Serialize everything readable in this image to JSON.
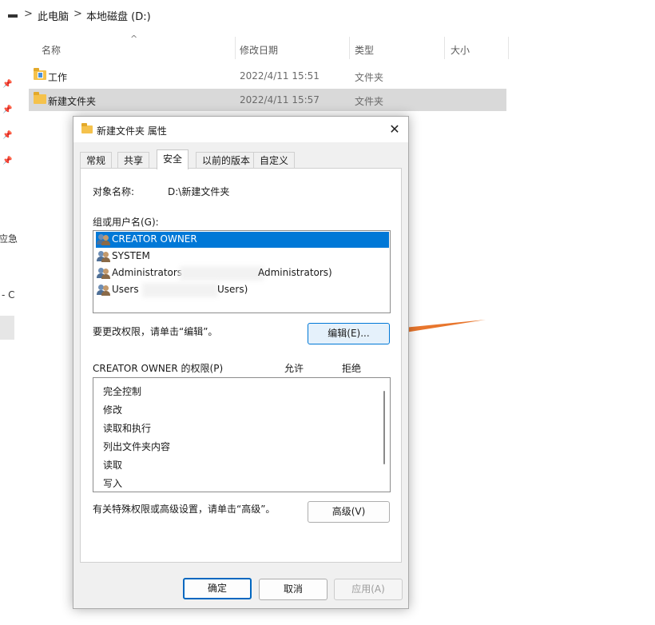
{
  "breadcrumb": {
    "sep1": ">",
    "item1": "此电脑",
    "sep2": ">",
    "item2": "本地磁盘 (D:)"
  },
  "columns": {
    "name": "名称",
    "date": "修改日期",
    "type": "类型",
    "size": "大小"
  },
  "files": [
    {
      "name": "工作",
      "date": "2022/4/11 15:51",
      "type": "文件夹"
    },
    {
      "name": "新建文件夹",
      "date": "2022/4/11 15:57",
      "type": "文件夹"
    }
  ],
  "left_fragments": [
    "应急",
    "- C"
  ],
  "dialog": {
    "title": "新建文件夹 属性",
    "close": "✕",
    "tabs": [
      "常规",
      "共享",
      "安全",
      "以前的版本",
      "自定义"
    ],
    "active_tab": "安全",
    "object_label": "对象名称:",
    "object_value": "D:\\新建文件夹",
    "group_label": "组或用户名(G):",
    "users": [
      {
        "name": "CREATOR OWNER",
        "selected": true
      },
      {
        "name": "SYSTEM",
        "selected": false
      },
      {
        "name": "Administrators",
        "suffix": "Administrators)",
        "selected": false
      },
      {
        "name": "Users",
        "suffix": "Users)",
        "selected": false
      }
    ],
    "edit_hint": "要更改权限，请单击“编辑”。",
    "edit_button": "编辑(E)...",
    "perm_label": "CREATOR OWNER 的权限(P)",
    "allow_label": "允许",
    "deny_label": "拒绝",
    "permissions": [
      "完全控制",
      "修改",
      "读取和执行",
      "列出文件夹内容",
      "读取",
      "写入"
    ],
    "advanced_hint": "有关特殊权限或高级设置，请单击“高级”。",
    "advanced_button": "高级(V)",
    "ok_button": "确定",
    "cancel_button": "取消",
    "apply_button": "应用(A)"
  },
  "colors": {
    "selection": "#0078d7",
    "annotation_arrow": "#e8762d",
    "folder": "#f5c24c"
  }
}
